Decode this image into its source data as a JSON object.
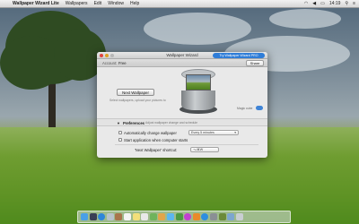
{
  "menubar": {
    "app_name": "Wallpaper Wizard Lite",
    "menus": [
      "Wallpapers",
      "Edit",
      "Window",
      "Help"
    ],
    "clock": "14:19"
  },
  "window": {
    "title": "Wallpaper Wizard",
    "promo_button": "Try Wallpaper Wizard PRO",
    "account_label": "Account:",
    "account_value": "Free",
    "share_button": "Share"
  },
  "main": {
    "next_button": "Next Wallpaper",
    "hint": "Select wallpapers, upload your pictures to",
    "magic_label": "Magic cube"
  },
  "preferences": {
    "heading": "Preferences",
    "description": "Adjust wallpaper change and schedule",
    "auto_change_label": "Automatically change wallpaper",
    "auto_change_interval": "Every 5 minutes",
    "start_label": "Start application when computer starts",
    "shortcut_label": "'Next Wallpaper' shortcut:",
    "shortcut_value": "⌥⌘W"
  },
  "colors": {
    "accent": "#2f7dd8",
    "grass": "#5f9325"
  },
  "dock_icons": [
    "finder-icon",
    "launchpad-icon",
    "safari-icon",
    "mail-icon",
    "contacts-icon",
    "calendar-icon",
    "notes-icon",
    "reminders-icon",
    "maps-icon",
    "photos-icon",
    "messages-icon",
    "facetime-icon",
    "itunes-icon",
    "ibooks-icon",
    "app-store-icon",
    "system-preferences-icon",
    "wallpaper-wizard-icon",
    "downloads-stack-icon",
    "trash-icon"
  ]
}
